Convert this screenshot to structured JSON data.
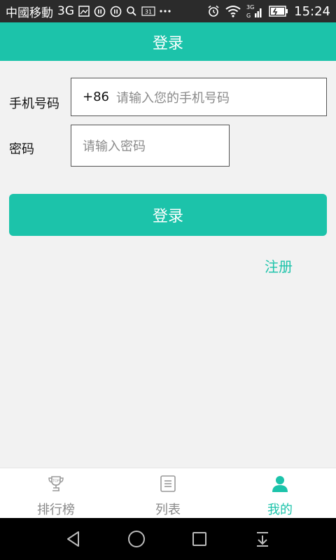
{
  "status_bar": {
    "carrier": "中國移動",
    "network": "3G",
    "time": "15:24",
    "icons_left": [
      "image-icon",
      "pause-circle-icon",
      "pause-circle-icon",
      "search-icon",
      "calendar-icon",
      "more-dots-icon"
    ],
    "icons_right": [
      "alarm-icon",
      "wifi-icon",
      "signal-icon",
      "battery-icon"
    ],
    "calendar_day": "31"
  },
  "header": {
    "title": "登录"
  },
  "form": {
    "phone_label": "手机号码",
    "phone_prefix": "+86",
    "phone_placeholder": "请输入您的手机号码",
    "password_label": "密码",
    "password_placeholder": "请输入密码"
  },
  "actions": {
    "login_label": "登录",
    "register_label": "注册"
  },
  "bottom_nav": {
    "items": [
      {
        "label": "排行榜",
        "icon": "trophy-icon",
        "active": false
      },
      {
        "label": "列表",
        "icon": "list-icon",
        "active": false
      },
      {
        "label": "我的",
        "icon": "user-icon",
        "active": true
      }
    ]
  },
  "colors": {
    "accent": "#1cc3aa",
    "status_bar": "#2b2b2b",
    "background": "#f2f2f2"
  }
}
